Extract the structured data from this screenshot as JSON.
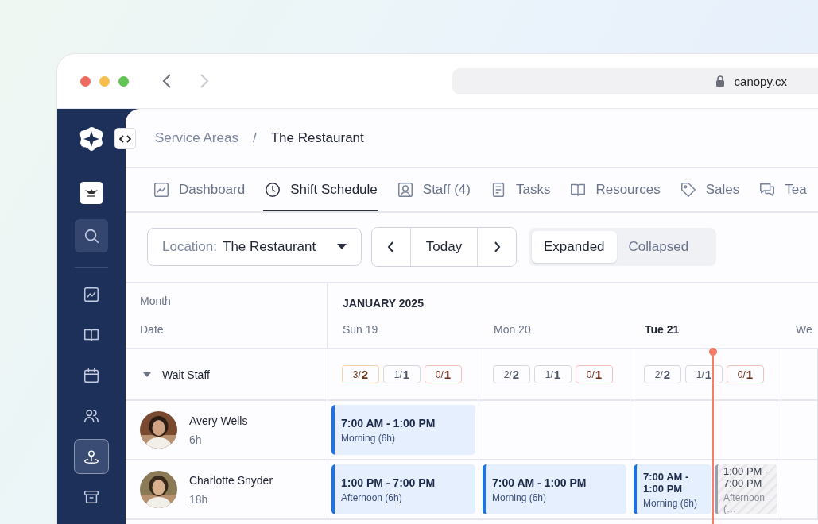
{
  "browser": {
    "url": "canopy.cx"
  },
  "sidebar": {
    "items": [
      {
        "selected": false
      },
      {
        "selected": false
      },
      {
        "selected": false
      },
      {
        "selected": false
      },
      {
        "selected": true
      },
      {
        "selected": false
      }
    ]
  },
  "breadcrumb": {
    "parent": "Service Areas",
    "separator": "/",
    "current": "The Restaurant"
  },
  "tabs": [
    {
      "label": "Dashboard",
      "selected": false
    },
    {
      "label": "Shift Schedule",
      "selected": true
    },
    {
      "label": "Staff (4)",
      "selected": false
    },
    {
      "label": "Tasks",
      "selected": false
    },
    {
      "label": "Resources",
      "selected": false
    },
    {
      "label": "Sales",
      "selected": false
    },
    {
      "label": "Tea",
      "selected": false
    }
  ],
  "toolbar": {
    "location_label": "Location:",
    "location_value": "The Restaurant",
    "today": "Today",
    "views": [
      {
        "label": "Expanded",
        "selected": true
      },
      {
        "label": "Collapsed",
        "selected": false
      }
    ]
  },
  "schedule": {
    "month_heading": "Month",
    "date_heading": "Date",
    "month": "JANUARY 2025",
    "days": [
      {
        "label": "Sun 19",
        "today": false
      },
      {
        "label": "Mon 20",
        "today": false
      },
      {
        "label": "Tue 21",
        "today": true
      },
      {
        "label": "We",
        "today": false
      }
    ],
    "groups": [
      {
        "name": "Wait Staff",
        "expanded": true,
        "staffing": [
          [
            {
              "text": "3/**2**",
              "color": "#f5d3a6"
            },
            {
              "text": "1/**1**",
              "color": "#d6d9e1"
            },
            {
              "text": "0/**1**",
              "color": "#f3c3bb"
            }
          ],
          [
            {
              "text": "2/**2**",
              "color": "#d6d9e1"
            },
            {
              "text": "1/**1**",
              "color": "#d6d9e1"
            },
            {
              "text": "0/**1**",
              "color": "#f3c3bb"
            }
          ],
          [
            {
              "text": "2/**2**",
              "color": "#d6d9e1"
            },
            {
              "text": "1/**1**",
              "color": "#d6d9e1"
            },
            {
              "text": "0/**1**",
              "color": "#f3c3bb"
            }
          ]
        ]
      }
    ],
    "staff": [
      {
        "name": "Avery Wells",
        "hours": "6h",
        "shifts": [
          [
            {
              "kind": "assigned",
              "time": "7:00 AM - 1:00 PM",
              "label": "Morning (6h)"
            }
          ]
        ]
      },
      {
        "name": "Charlotte Snyder",
        "hours": "18h",
        "shifts": [
          [
            {
              "kind": "assigned",
              "time": "1:00 PM - 7:00 PM",
              "label": "Afternoon (6h)"
            }
          ],
          [
            {
              "kind": "assigned",
              "time": "7:00 AM - 1:00 PM",
              "label": "Morning (6h)"
            }
          ],
          [
            {
              "kind": "assigned",
              "time": "7:00 AM - 1:00 PM",
              "label": "Morning (6h)"
            },
            {
              "kind": "open",
              "time": "1:00 PM - 7:00 PM",
              "label": "Afternoon (…"
            }
          ]
        ]
      }
    ]
  }
}
